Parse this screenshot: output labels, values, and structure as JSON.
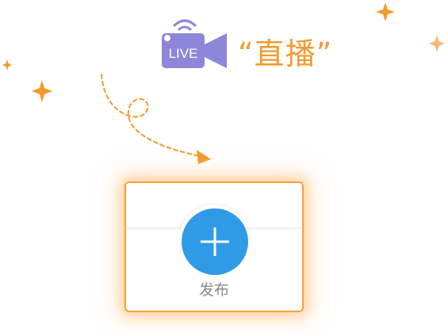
{
  "headline": {
    "text": "“直播”"
  },
  "live_icon": {
    "badge_text": "LIVE",
    "icon": "live-video-camera-icon",
    "color": "#8c87d8"
  },
  "card": {
    "publish_label": "发布",
    "button_icon": "plus-icon",
    "button_color": "#2f9be6",
    "border_color": "#f6a035"
  },
  "decor": {
    "accent_color": "#f39a2e",
    "sparkle_icon": "sparkle-icon",
    "arrow_icon": "dashed-curved-arrow-icon"
  }
}
